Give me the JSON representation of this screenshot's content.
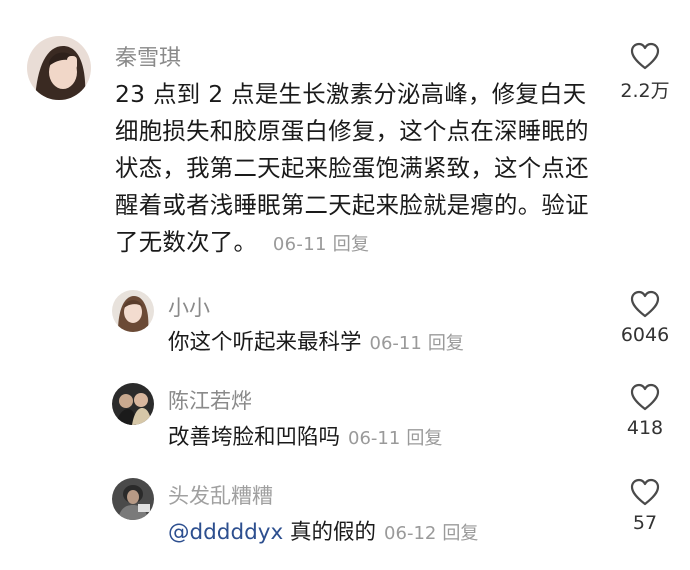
{
  "comments": [
    {
      "username": "秦雪琪",
      "text": "23 点到 2 点是生长激素分泌高峰，修复白天细胞损失和胶原蛋白修复，这个点在深睡眠的状态，我第二天起来脸蛋饱满紧致，这个点还醒着或者浅睡眠第二天起来脸就是瘪的。验证了无数次了。",
      "date": "06-11",
      "reply_label": "回复",
      "likes": "2.2万",
      "avatar_icon": "avatar-photo"
    }
  ],
  "replies": [
    {
      "username": "小小",
      "text": "你这个听起来最科学",
      "date": "06-11",
      "reply_label": "回复",
      "likes": "6046",
      "avatar_icon": "avatar-photo"
    },
    {
      "username": "陈江若烨",
      "text": "改善垮脸和凹陷吗",
      "date": "06-11",
      "reply_label": "回复",
      "likes": "418",
      "avatar_icon": "avatar-photo"
    },
    {
      "username": "头发乱糟糟",
      "mention": "@dddddyx",
      "text": "真的假的",
      "date": "06-12",
      "reply_label": "回复",
      "likes": "57",
      "avatar_icon": "avatar-photo"
    }
  ],
  "icons": {
    "like": "heart-outline-icon"
  },
  "colors": {
    "text": "#1a1a1a",
    "muted": "#8a8a8a",
    "mention": "#2d4f8f"
  }
}
